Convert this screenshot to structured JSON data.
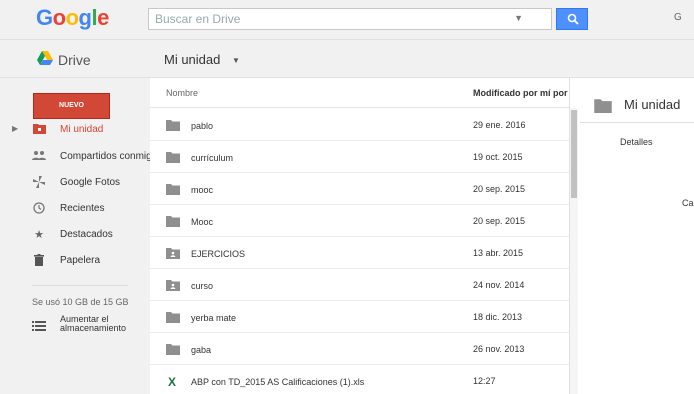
{
  "header": {
    "logo_letters": [
      "G",
      "o",
      "o",
      "g",
      "l",
      "e"
    ],
    "search_placeholder": "Buscar en Drive",
    "account_text": "G"
  },
  "subbar": {
    "app_label": "Drive",
    "breadcrumb": "Mi unidad"
  },
  "sidebar": {
    "new_label": "NUEVO",
    "items": [
      {
        "label": "Mi unidad",
        "icon": "drive-folder-icon",
        "active": true
      },
      {
        "label": "Compartidos conmigo",
        "icon": "people-icon"
      },
      {
        "label": "Google Fotos",
        "icon": "pinwheel-icon"
      },
      {
        "label": "Recientes",
        "icon": "clock-icon"
      },
      {
        "label": "Destacados",
        "icon": "star-icon"
      },
      {
        "label": "Papelera",
        "icon": "trash-icon"
      }
    ],
    "storage": "Se usó 10 GB de 15 GB",
    "upgrade_line1": "Aumentar el",
    "upgrade_line2": "almacenamiento"
  },
  "list": {
    "col_name": "Nombre",
    "col_modified": "Modificado por mí por ú",
    "rows": [
      {
        "name": "pablo",
        "date": "29 ene. 2016",
        "icon": "folder-icon"
      },
      {
        "name": "currículum",
        "date": "19 oct. 2015",
        "icon": "folder-icon"
      },
      {
        "name": "mooc",
        "date": "20 sep. 2015",
        "icon": "folder-icon"
      },
      {
        "name": "Mooc",
        "date": "20 sep. 2015",
        "icon": "folder-icon"
      },
      {
        "name": "EJERCICIOS",
        "date": "13 abr. 2015",
        "icon": "shared-folder-icon"
      },
      {
        "name": "curso",
        "date": "24 nov. 2014",
        "icon": "shared-folder-icon"
      },
      {
        "name": "yerba mate",
        "date": "18 dic. 2013",
        "icon": "folder-icon"
      },
      {
        "name": "gaba",
        "date": "26 nov. 2013",
        "icon": "folder-icon"
      },
      {
        "name": "ABP con TD_2015 AS Calificaciones (1).xls",
        "date": "12:27",
        "icon": "excel-icon"
      }
    ]
  },
  "details": {
    "title": "Mi unidad",
    "tab": "Detalles",
    "cut_text": "Ca"
  },
  "colors": {
    "accent_red": "#d14836",
    "search_blue": "#4d90fe",
    "excel_green": "#1e7145"
  }
}
